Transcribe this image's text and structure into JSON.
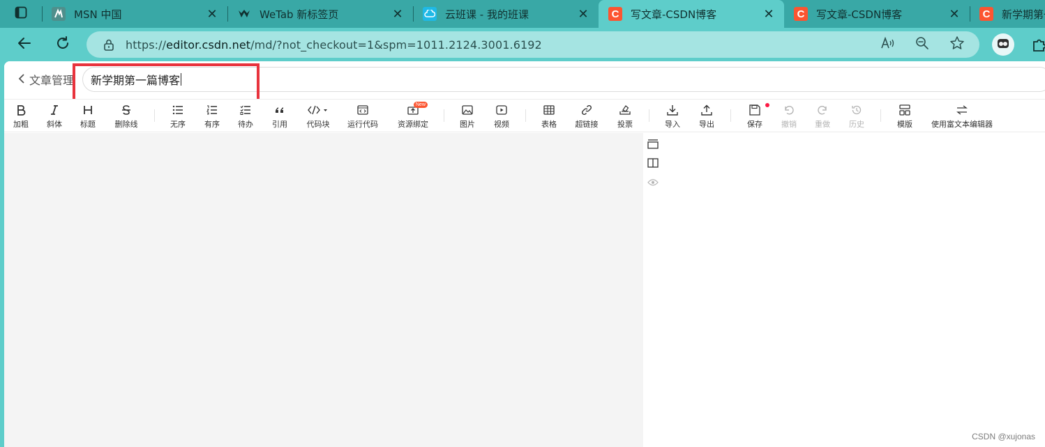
{
  "browser": {
    "tabs": [
      {
        "title": "MSN 中国",
        "favicon": "msn-icon"
      },
      {
        "title": "WeTab 新标签页",
        "favicon": "wetab-icon"
      },
      {
        "title": "云班课 - 我的班课",
        "favicon": "cloud-class-icon"
      },
      {
        "title": "写文章-CSDN博客",
        "favicon": "csdn-icon",
        "active": true
      },
      {
        "title": "写文章-CSDN博客",
        "favicon": "csdn-icon"
      },
      {
        "title": "新学期第一",
        "favicon": "csdn-icon"
      }
    ],
    "address": {
      "prefix": "https://",
      "host": "editor.csdn.net",
      "path": "/md/?not_checkout=1&spm=1011.2124.3001.6192"
    },
    "colors": {
      "accent": "#5ecdca",
      "tabstrip": "#39a8a6",
      "csdn": "#fc5531"
    }
  },
  "editor": {
    "back_label": "文章管理",
    "title_value": "新学期第一篇博客",
    "toolbar": [
      {
        "label": "加粗",
        "icon": "bold-icon"
      },
      {
        "label": "斜体",
        "icon": "italic-icon"
      },
      {
        "label": "标题",
        "icon": "heading-icon"
      },
      {
        "label": "删除线",
        "icon": "strikethrough-icon"
      },
      {
        "label": "无序",
        "icon": "unordered-list-icon"
      },
      {
        "label": "有序",
        "icon": "ordered-list-icon"
      },
      {
        "label": "待办",
        "icon": "todo-list-icon"
      },
      {
        "label": "引用",
        "icon": "quote-icon"
      },
      {
        "label": "代码块",
        "icon": "code-block-icon"
      },
      {
        "label": "运行代码",
        "icon": "run-code-icon"
      },
      {
        "label": "资源绑定",
        "icon": "resource-bind-icon",
        "badge": "New"
      },
      {
        "label": "图片",
        "icon": "image-icon"
      },
      {
        "label": "视频",
        "icon": "video-icon"
      },
      {
        "label": "表格",
        "icon": "table-icon"
      },
      {
        "label": "超链接",
        "icon": "link-icon"
      },
      {
        "label": "投票",
        "icon": "vote-icon"
      },
      {
        "label": "导入",
        "icon": "import-icon"
      },
      {
        "label": "导出",
        "icon": "export-icon"
      },
      {
        "label": "保存",
        "icon": "save-icon"
      },
      {
        "label": "撤销",
        "icon": "undo-icon",
        "disabled": true
      },
      {
        "label": "重做",
        "icon": "redo-icon",
        "disabled": true
      },
      {
        "label": "历史",
        "icon": "history-icon",
        "disabled": true
      },
      {
        "label": "模版",
        "icon": "template-icon"
      },
      {
        "label": "使用富文本编辑器",
        "icon": "switch-editor-icon"
      }
    ],
    "watermark": "CSDN @xujonas"
  }
}
